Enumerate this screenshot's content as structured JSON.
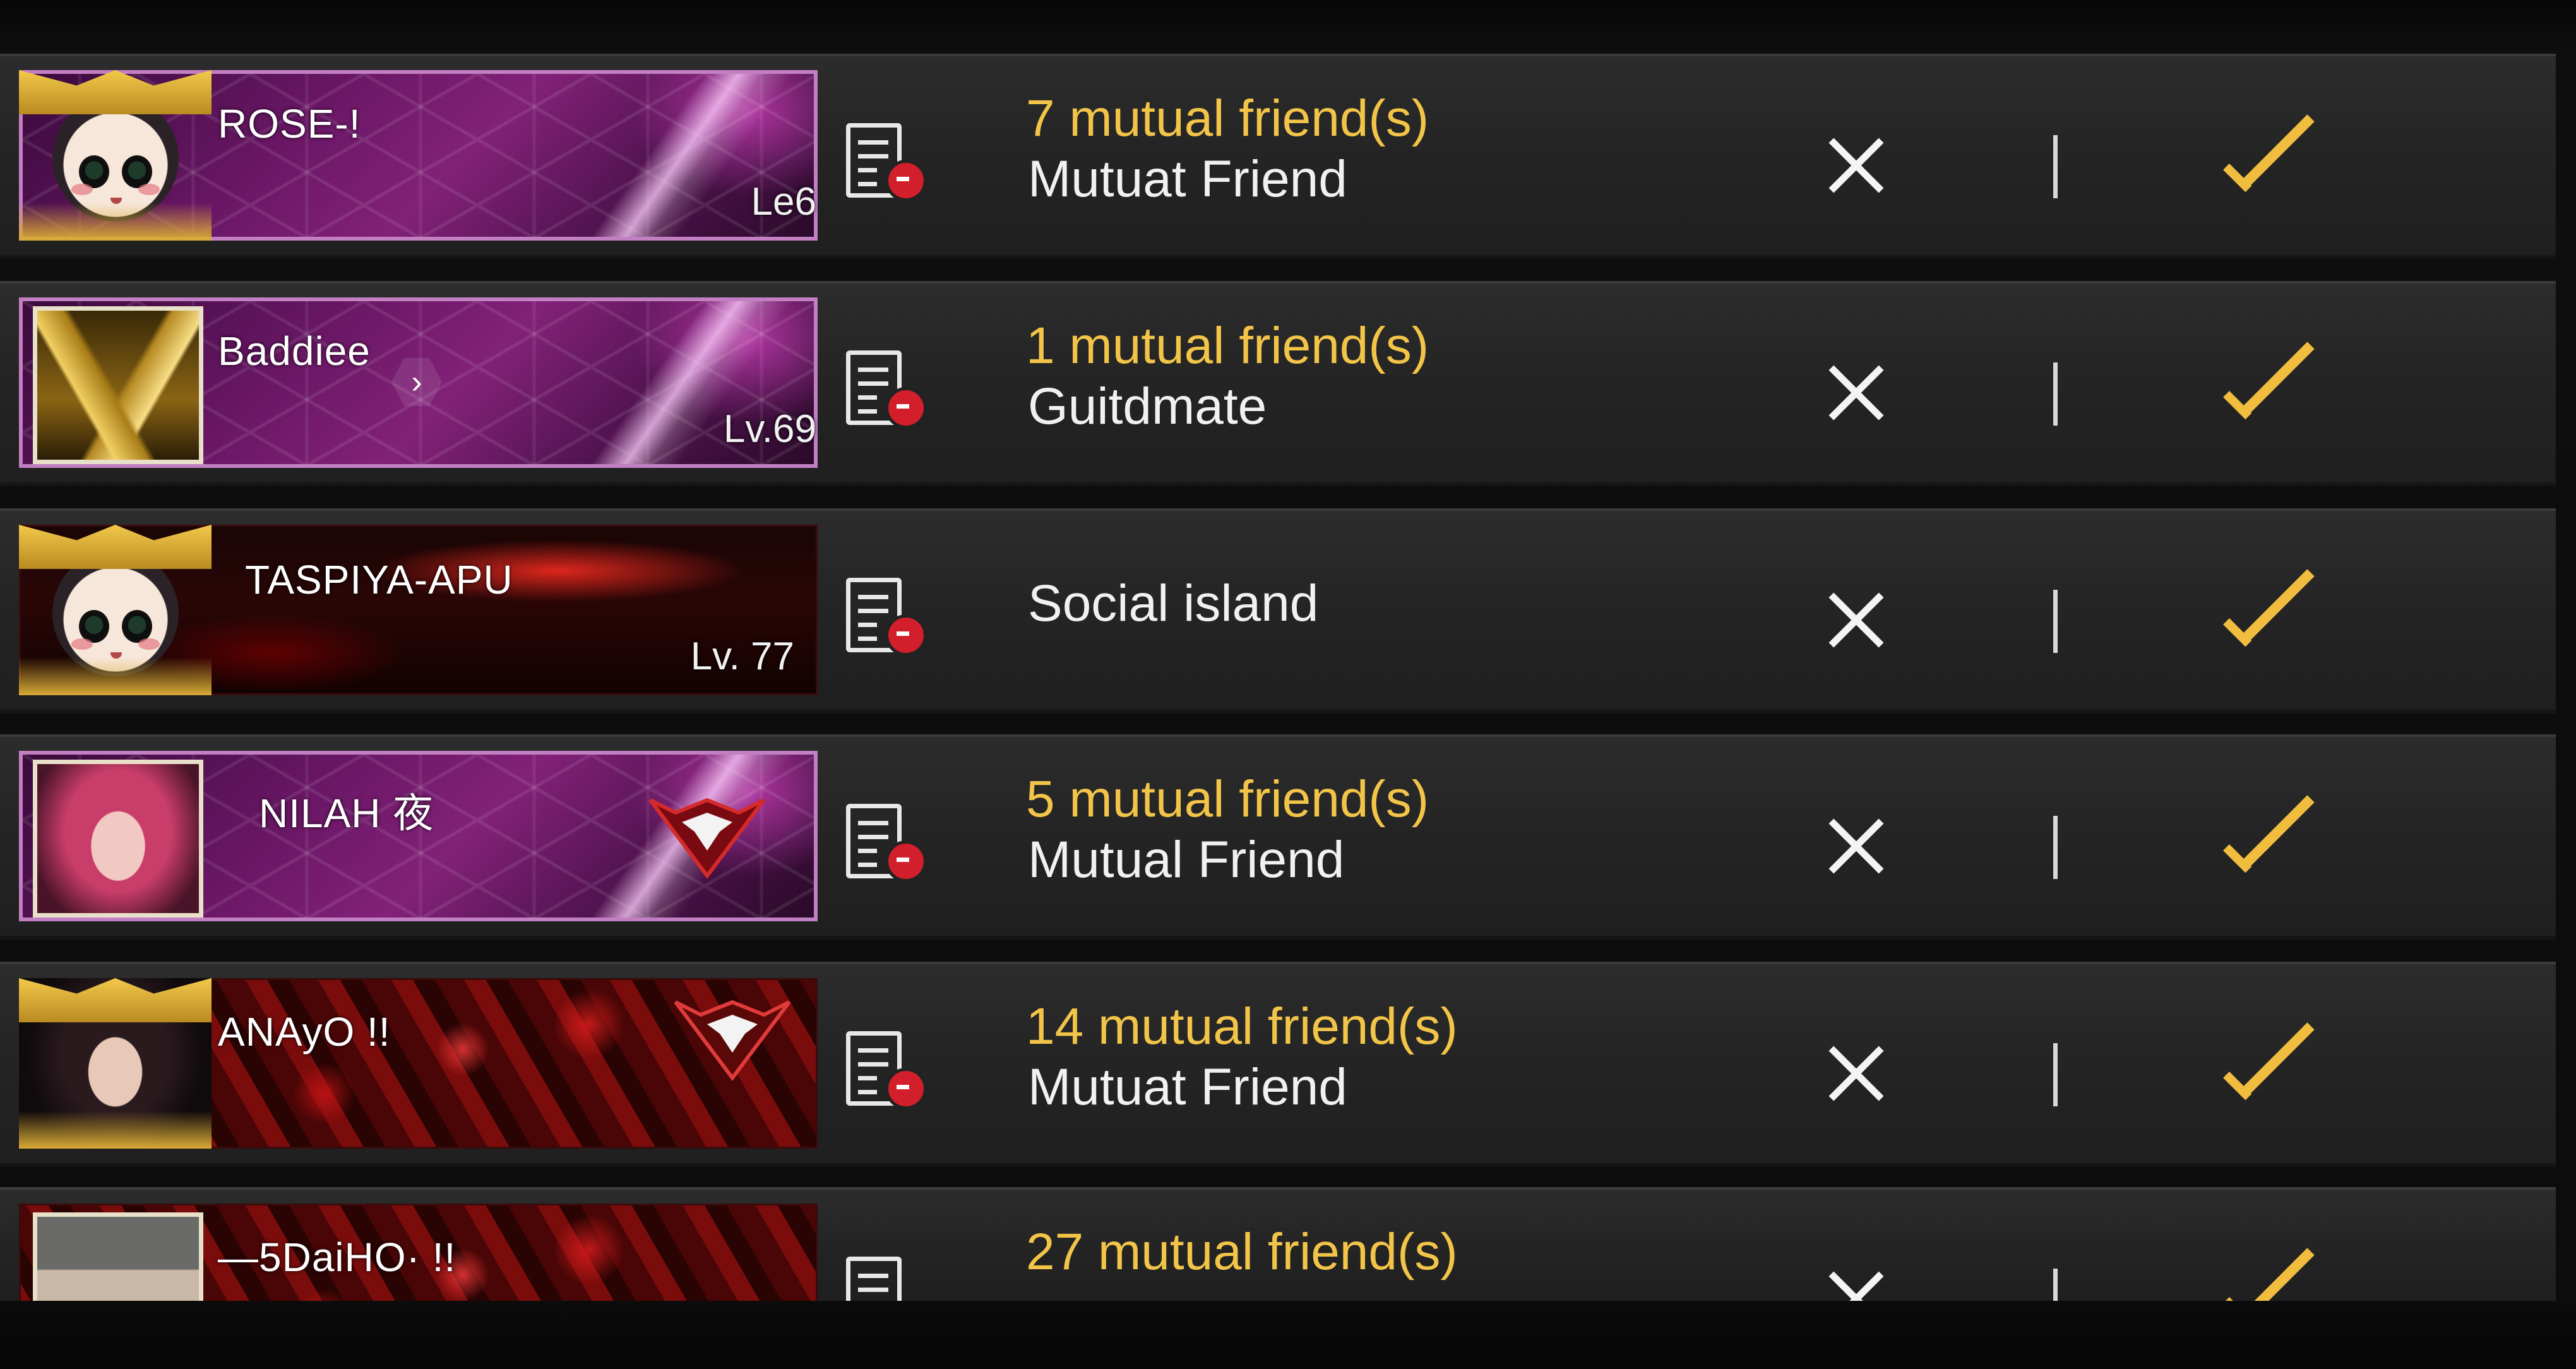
{
  "requests": [
    {
      "name": "ROSE-!",
      "level": "Le6",
      "mutual": "7 mutual friend(s)",
      "source": "Mutuat Friend"
    },
    {
      "name": "Baddiee",
      "level": "Lv.69",
      "mutual": "1 mutual friend(s)",
      "source": "Guitdmate"
    },
    {
      "name": "TASPIYA-APU",
      "level": "Lv. 77",
      "mutual": "",
      "source": "Social island"
    },
    {
      "name": "NILAH 夜",
      "level": "",
      "mutual": "5 mutual friend(s)",
      "source": "Mutual Friend"
    },
    {
      "name": "ANAyO !!",
      "level": "",
      "mutual": "14 mutual friend(s)",
      "source": "Mutuat Friend"
    },
    {
      "name": "—5DaiHO· !!",
      "level": "",
      "mutual": "27 mutual friend(s)",
      "source": ""
    }
  ],
  "colors": {
    "accent_gold": "#f2c448",
    "text_white": "#f1f1f1",
    "profile_badge_red": "#d21f2b",
    "row_background": "#262626"
  },
  "icons": {
    "profile": "profile-card-icon",
    "reject": "close-icon",
    "accept": "checkmark-icon"
  }
}
